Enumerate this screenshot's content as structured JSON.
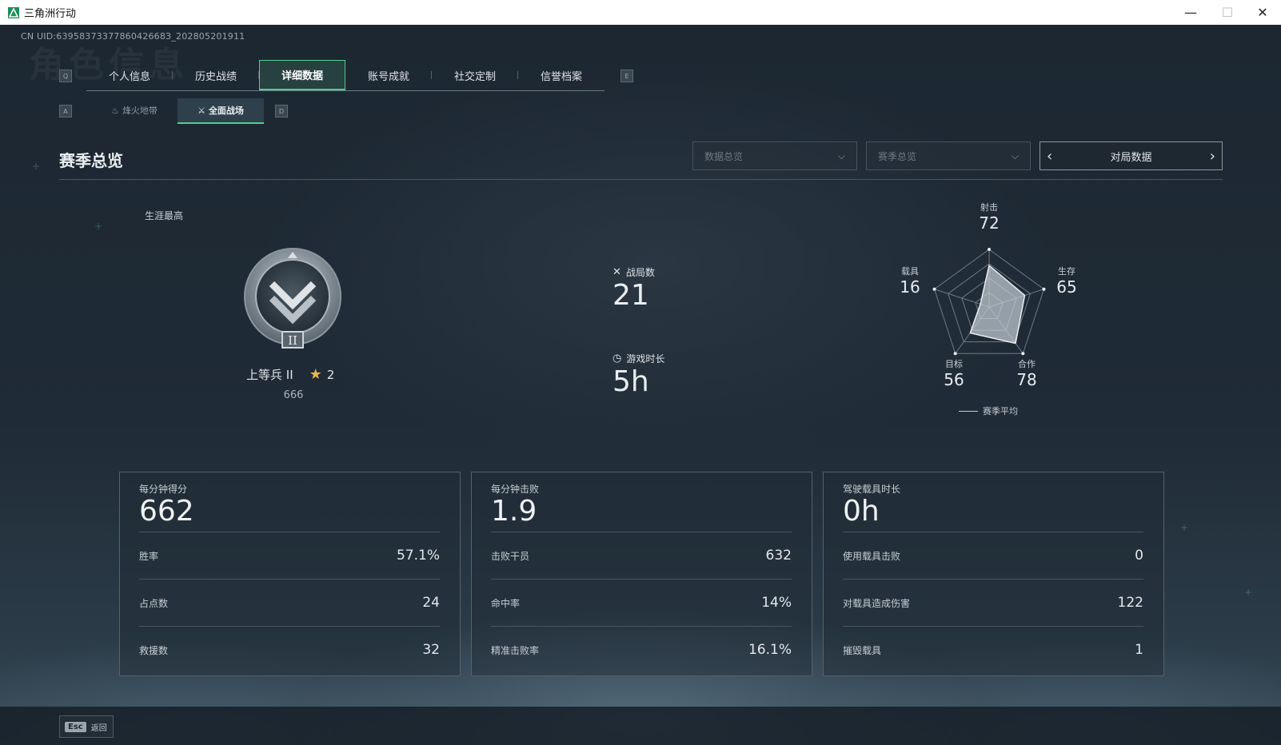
{
  "window": {
    "title": "三角洲行动"
  },
  "uid": "CN UID:6395837337786042668З_202805201911",
  "tabs": [
    {
      "label": "个人信息",
      "active": false
    },
    {
      "label": "历史战绩",
      "active": false
    },
    {
      "label": "详细数据",
      "active": true
    },
    {
      "label": "账号成就",
      "active": false
    },
    {
      "label": "社交定制",
      "active": false
    },
    {
      "label": "信誉档案",
      "active": false
    }
  ],
  "keyhints": {
    "tab_prev": "Q",
    "tab_next": "E",
    "sub_prev": "A",
    "sub_next": "D",
    "back": "Esc"
  },
  "subtabs": [
    {
      "label": "烽火地带",
      "icon": "flame-icon",
      "active": false
    },
    {
      "label": "全面战场",
      "icon": "battlefield-icon",
      "active": true
    }
  ],
  "section_title": "赛季总览",
  "filters": {
    "data_dropdown": "数据总览",
    "season_dropdown": "赛季总览",
    "pager_label": "对局数据"
  },
  "career": {
    "label": "生涯最高",
    "rank_name": "上等兵 II",
    "rank_tier": "II",
    "stars": "2",
    "score": "666"
  },
  "match_stats": {
    "matches_label": "战局数",
    "matches_value": "21",
    "playtime_label": "游戏时长",
    "playtime_value": "5h"
  },
  "radar": {
    "axes": [
      {
        "name": "射击",
        "value": "72"
      },
      {
        "name": "生存",
        "value": "65"
      },
      {
        "name": "合作",
        "value": "78"
      },
      {
        "name": "目标",
        "value": "56"
      },
      {
        "name": "载具",
        "value": "16"
      }
    ],
    "legend": "赛季平均"
  },
  "cards": [
    {
      "head": "每分钟得分",
      "big": "662",
      "rows": [
        {
          "k": "胜率",
          "v": "57.1%"
        },
        {
          "k": "占点数",
          "v": "24"
        },
        {
          "k": "救援数",
          "v": "32"
        }
      ]
    },
    {
      "head": "每分钟击败",
      "big": "1.9",
      "rows": [
        {
          "k": "击败干员",
          "v": "632"
        },
        {
          "k": "命中率",
          "v": "14%"
        },
        {
          "k": "精准击败率",
          "v": "16.1%"
        }
      ]
    },
    {
      "head": "驾驶载具时长",
      "big": "0h",
      "rows": [
        {
          "k": "使用载具击败",
          "v": "0"
        },
        {
          "k": "对载具造成伤害",
          "v": "122"
        },
        {
          "k": "摧毁载具",
          "v": "1"
        }
      ]
    }
  ],
  "footer": {
    "back_label": "返回"
  },
  "colors": {
    "accent": "#4fd08c",
    "star": "#e6b84a"
  }
}
